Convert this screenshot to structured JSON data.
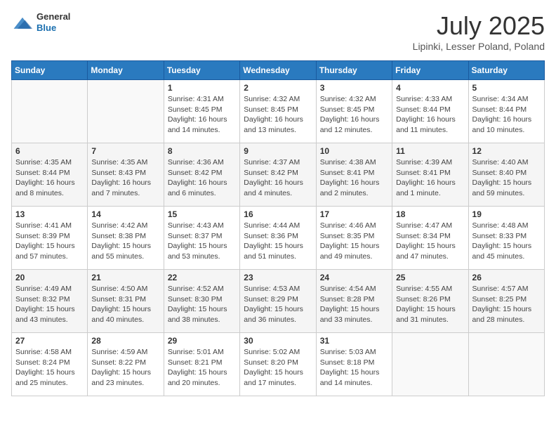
{
  "logo": {
    "general": "General",
    "blue": "Blue"
  },
  "header": {
    "month": "July 2025",
    "location": "Lipinki, Lesser Poland, Poland"
  },
  "weekdays": [
    "Sunday",
    "Monday",
    "Tuesday",
    "Wednesday",
    "Thursday",
    "Friday",
    "Saturday"
  ],
  "weeks": [
    [
      {
        "day": "",
        "info": ""
      },
      {
        "day": "",
        "info": ""
      },
      {
        "day": "1",
        "info": "Sunrise: 4:31 AM\nSunset: 8:45 PM\nDaylight: 16 hours and 14 minutes."
      },
      {
        "day": "2",
        "info": "Sunrise: 4:32 AM\nSunset: 8:45 PM\nDaylight: 16 hours and 13 minutes."
      },
      {
        "day": "3",
        "info": "Sunrise: 4:32 AM\nSunset: 8:45 PM\nDaylight: 16 hours and 12 minutes."
      },
      {
        "day": "4",
        "info": "Sunrise: 4:33 AM\nSunset: 8:44 PM\nDaylight: 16 hours and 11 minutes."
      },
      {
        "day": "5",
        "info": "Sunrise: 4:34 AM\nSunset: 8:44 PM\nDaylight: 16 hours and 10 minutes."
      }
    ],
    [
      {
        "day": "6",
        "info": "Sunrise: 4:35 AM\nSunset: 8:44 PM\nDaylight: 16 hours and 8 minutes."
      },
      {
        "day": "7",
        "info": "Sunrise: 4:35 AM\nSunset: 8:43 PM\nDaylight: 16 hours and 7 minutes."
      },
      {
        "day": "8",
        "info": "Sunrise: 4:36 AM\nSunset: 8:42 PM\nDaylight: 16 hours and 6 minutes."
      },
      {
        "day": "9",
        "info": "Sunrise: 4:37 AM\nSunset: 8:42 PM\nDaylight: 16 hours and 4 minutes."
      },
      {
        "day": "10",
        "info": "Sunrise: 4:38 AM\nSunset: 8:41 PM\nDaylight: 16 hours and 2 minutes."
      },
      {
        "day": "11",
        "info": "Sunrise: 4:39 AM\nSunset: 8:41 PM\nDaylight: 16 hours and 1 minute."
      },
      {
        "day": "12",
        "info": "Sunrise: 4:40 AM\nSunset: 8:40 PM\nDaylight: 15 hours and 59 minutes."
      }
    ],
    [
      {
        "day": "13",
        "info": "Sunrise: 4:41 AM\nSunset: 8:39 PM\nDaylight: 15 hours and 57 minutes."
      },
      {
        "day": "14",
        "info": "Sunrise: 4:42 AM\nSunset: 8:38 PM\nDaylight: 15 hours and 55 minutes."
      },
      {
        "day": "15",
        "info": "Sunrise: 4:43 AM\nSunset: 8:37 PM\nDaylight: 15 hours and 53 minutes."
      },
      {
        "day": "16",
        "info": "Sunrise: 4:44 AM\nSunset: 8:36 PM\nDaylight: 15 hours and 51 minutes."
      },
      {
        "day": "17",
        "info": "Sunrise: 4:46 AM\nSunset: 8:35 PM\nDaylight: 15 hours and 49 minutes."
      },
      {
        "day": "18",
        "info": "Sunrise: 4:47 AM\nSunset: 8:34 PM\nDaylight: 15 hours and 47 minutes."
      },
      {
        "day": "19",
        "info": "Sunrise: 4:48 AM\nSunset: 8:33 PM\nDaylight: 15 hours and 45 minutes."
      }
    ],
    [
      {
        "day": "20",
        "info": "Sunrise: 4:49 AM\nSunset: 8:32 PM\nDaylight: 15 hours and 43 minutes."
      },
      {
        "day": "21",
        "info": "Sunrise: 4:50 AM\nSunset: 8:31 PM\nDaylight: 15 hours and 40 minutes."
      },
      {
        "day": "22",
        "info": "Sunrise: 4:52 AM\nSunset: 8:30 PM\nDaylight: 15 hours and 38 minutes."
      },
      {
        "day": "23",
        "info": "Sunrise: 4:53 AM\nSunset: 8:29 PM\nDaylight: 15 hours and 36 minutes."
      },
      {
        "day": "24",
        "info": "Sunrise: 4:54 AM\nSunset: 8:28 PM\nDaylight: 15 hours and 33 minutes."
      },
      {
        "day": "25",
        "info": "Sunrise: 4:55 AM\nSunset: 8:26 PM\nDaylight: 15 hours and 31 minutes."
      },
      {
        "day": "26",
        "info": "Sunrise: 4:57 AM\nSunset: 8:25 PM\nDaylight: 15 hours and 28 minutes."
      }
    ],
    [
      {
        "day": "27",
        "info": "Sunrise: 4:58 AM\nSunset: 8:24 PM\nDaylight: 15 hours and 25 minutes."
      },
      {
        "day": "28",
        "info": "Sunrise: 4:59 AM\nSunset: 8:22 PM\nDaylight: 15 hours and 23 minutes."
      },
      {
        "day": "29",
        "info": "Sunrise: 5:01 AM\nSunset: 8:21 PM\nDaylight: 15 hours and 20 minutes."
      },
      {
        "day": "30",
        "info": "Sunrise: 5:02 AM\nSunset: 8:20 PM\nDaylight: 15 hours and 17 minutes."
      },
      {
        "day": "31",
        "info": "Sunrise: 5:03 AM\nSunset: 8:18 PM\nDaylight: 15 hours and 14 minutes."
      },
      {
        "day": "",
        "info": ""
      },
      {
        "day": "",
        "info": ""
      }
    ]
  ]
}
